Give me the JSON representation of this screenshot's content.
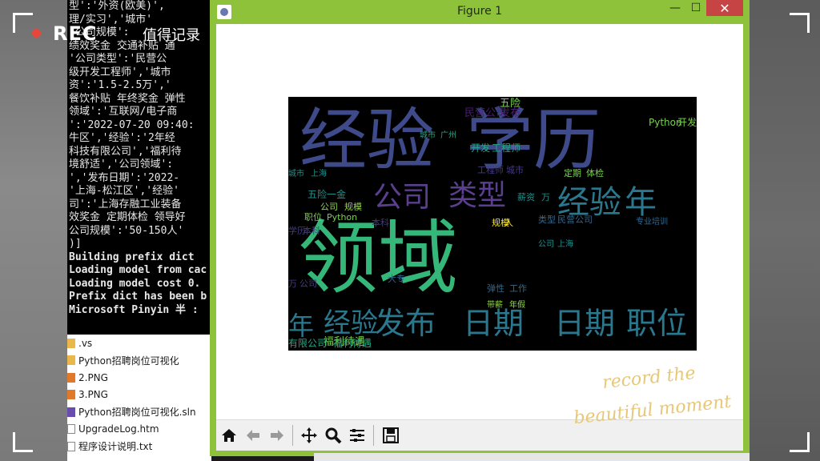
{
  "overlay": {
    "rec_label": "REC",
    "rec_subtitle": "值得记录",
    "script_line1": "record the",
    "script_line2": "beautiful moment"
  },
  "console": {
    "lines": [
      "型':'外资(欧美)',",
      "理/实习','城市'",
      "'公司规模':",
      "绩效奖金 交通补贴 通",
      "'公司类型':'民营公",
      "级开发工程师','城市",
      "资':'1.5-2.5万','",
      "餐饮补贴 年终奖金 弹性",
      "领域':'互联网/电子商",
      "':'2022-07-20 09:40:",
      "牛区','经验':'2年经",
      "科技有限公司','福利待",
      "境舒适','公司领域':",
      "','发布日期':'2022-",
      "'上海-松江区','经验'",
      "司':'上海存融工业装备",
      "效奖金 定期体检 领导好",
      "公司规模':'50-150人'",
      ")]",
      "Building prefix dict",
      "Loading model from cac",
      "Loading model cost 0.",
      "Prefix dict has been b",
      "",
      "Microsoft Pinyin 半 :"
    ]
  },
  "explorer": {
    "items": [
      {
        "name": ".vs",
        "icon": "folder-icon"
      },
      {
        "name": "Python招聘岗位可视化",
        "icon": "folder-icon"
      },
      {
        "name": "2.PNG",
        "icon": "png-file-icon"
      },
      {
        "name": "3.PNG",
        "icon": "png-file-icon"
      },
      {
        "name": "Python招聘岗位可视化.sln",
        "icon": "sln-file-icon"
      },
      {
        "name": "UpgradeLog.htm",
        "icon": "document-icon"
      },
      {
        "name": "程序设计说明.txt",
        "icon": "document-icon"
      }
    ]
  },
  "figure_window": {
    "title": "Figure 1",
    "minimize_glyph": "—",
    "maximize_glyph": "☐",
    "close_glyph": "✕",
    "toolbar": [
      "home-icon",
      "back-arrow-icon",
      "forward-arrow-icon",
      "pan-icon",
      "zoom-icon",
      "configure-subplots-icon",
      "save-icon"
    ]
  },
  "word_cloud": {
    "words": [
      "经验",
      "学历",
      "公司",
      "领域",
      "类型",
      "经验",
      "年",
      "年",
      "经验",
      "发布",
      "日期",
      "日期",
      "职位",
      "福利待遇",
      "五险",
      "民营公司",
      "发布",
      "开发",
      "工程师",
      "工程师",
      "城市",
      "五险一金",
      "薪资",
      "万",
      "公司",
      "规模",
      "职位",
      "Python",
      "Python",
      "开发",
      "本科",
      "类型",
      "民营公司",
      "学历",
      "本科",
      "大专",
      "万",
      "公司",
      "规模",
      "人",
      "弹性",
      "工作",
      "有限公司",
      "福利待遇",
      "定期",
      "体检",
      "城市",
      "上海",
      "城市",
      "广州",
      "公司",
      "上海",
      "专业培训",
      "带薪",
      "年假"
    ],
    "colors": [
      "#3e4a89",
      "#5b3f8f",
      "#35b779",
      "#2a788e",
      "#7ad151",
      "#481f70",
      "#22a884",
      "#443a83",
      "#21918c",
      "#90d743",
      "#31688e",
      "#fde725"
    ]
  }
}
